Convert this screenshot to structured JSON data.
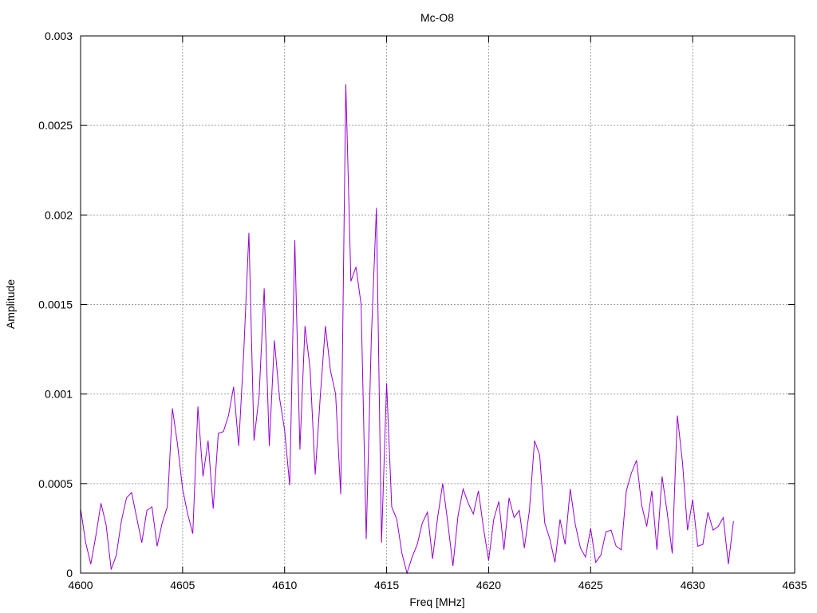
{
  "chart_data": {
    "type": "line",
    "title": "Mc-O8",
    "xlabel": "Freq [MHz]",
    "ylabel": "Amplitude",
    "xlim": [
      4600,
      4635
    ],
    "ylim": [
      0,
      0.003
    ],
    "xticks": [
      "4600",
      "4605",
      "4610",
      "4615",
      "4620",
      "4625",
      "4630",
      "4635"
    ],
    "yticks": [
      "0",
      "0.0005",
      "0.001",
      "0.0015",
      "0.002",
      "0.0025",
      "0.003"
    ],
    "grid": true,
    "legend": "none",
    "series": [
      {
        "color": "#9400d3",
        "x": [
          4600.0,
          4600.25,
          4600.5,
          4600.75,
          4601.0,
          4601.25,
          4601.5,
          4601.75,
          4602.0,
          4602.25,
          4602.5,
          4602.75,
          4603.0,
          4603.25,
          4603.5,
          4603.75,
          4604.0,
          4604.25,
          4604.5,
          4604.75,
          4605.0,
          4605.25,
          4605.5,
          4605.75,
          4606.0,
          4606.25,
          4606.5,
          4606.75,
          4607.0,
          4607.25,
          4607.5,
          4607.75,
          4608.0,
          4608.25,
          4608.5,
          4608.75,
          4609.0,
          4609.25,
          4609.5,
          4609.75,
          4610.0,
          4610.25,
          4610.5,
          4610.75,
          4611.0,
          4611.25,
          4611.5,
          4611.75,
          4612.0,
          4612.25,
          4612.5,
          4612.75,
          4613.0,
          4613.25,
          4613.5,
          4613.75,
          4614.0,
          4614.25,
          4614.5,
          4614.75,
          4615.0,
          4615.25,
          4615.5,
          4615.75,
          4616.0,
          4616.25,
          4616.5,
          4616.75,
          4617.0,
          4617.25,
          4617.5,
          4617.75,
          4618.0,
          4618.25,
          4618.5,
          4618.75,
          4619.0,
          4619.25,
          4619.5,
          4619.75,
          4620.0,
          4620.25,
          4620.5,
          4620.75,
          4621.0,
          4621.25,
          4621.5,
          4621.75,
          4622.0,
          4622.25,
          4622.5,
          4622.75,
          4623.0,
          4623.25,
          4623.5,
          4623.75,
          4624.0,
          4624.25,
          4624.5,
          4624.75,
          4625.0,
          4625.25,
          4625.5,
          4625.75,
          4626.0,
          4626.25,
          4626.5,
          4626.75,
          4627.0,
          4627.25,
          4627.5,
          4627.75,
          4628.0,
          4628.25,
          4628.5,
          4628.75,
          4629.0,
          4629.25,
          4629.5,
          4629.75,
          4630.0,
          4630.25,
          4630.5,
          4630.75,
          4631.0,
          4631.25,
          4631.5,
          4631.75,
          4632.0
        ],
        "y": [
          0.00036,
          0.00017,
          5e-05,
          0.00021,
          0.00039,
          0.00027,
          2e-05,
          0.0001,
          0.00029,
          0.00042,
          0.00045,
          0.00031,
          0.00017,
          0.00035,
          0.00037,
          0.00015,
          0.00028,
          0.00037,
          0.00092,
          0.00072,
          0.00047,
          0.00033,
          0.00022,
          0.00093,
          0.00054,
          0.00074,
          0.00036,
          0.00078,
          0.00079,
          0.00088,
          0.00104,
          0.00071,
          0.00124,
          0.0019,
          0.00074,
          0.00099,
          0.00159,
          0.00071,
          0.0013,
          0.00098,
          0.0008,
          0.00049,
          0.00186,
          0.00069,
          0.00138,
          0.00114,
          0.00055,
          0.00099,
          0.00138,
          0.00113,
          0.001,
          0.00044,
          0.00273,
          0.00163,
          0.00171,
          0.0015,
          0.00019,
          0.00131,
          0.00204,
          0.00017,
          0.00106,
          0.00037,
          0.0003,
          0.00011,
          0.0,
          9e-05,
          0.00016,
          0.00028,
          0.00034,
          8e-05,
          0.00031,
          0.0005,
          0.00028,
          4e-05,
          0.00032,
          0.00047,
          0.00039,
          0.00033,
          0.00046,
          0.00025,
          7e-05,
          0.0003,
          0.0004,
          0.00013,
          0.00042,
          0.00031,
          0.00035,
          0.00014,
          0.00035,
          0.00074,
          0.00066,
          0.00028,
          0.00019,
          6e-05,
          0.0003,
          0.00016,
          0.00047,
          0.00027,
          0.00014,
          9e-05,
          0.00025,
          6e-05,
          0.0001,
          0.00023,
          0.00024,
          0.00015,
          0.00013,
          0.00046,
          0.00056,
          0.00063,
          0.00038,
          0.00026,
          0.00046,
          0.00013,
          0.00054,
          0.00034,
          0.00011,
          0.00088,
          0.00062,
          0.00024,
          0.00041,
          0.00015,
          0.00016,
          0.00034,
          0.00024,
          0.00026,
          0.00031,
          5e-05,
          0.00029
        ]
      }
    ]
  }
}
